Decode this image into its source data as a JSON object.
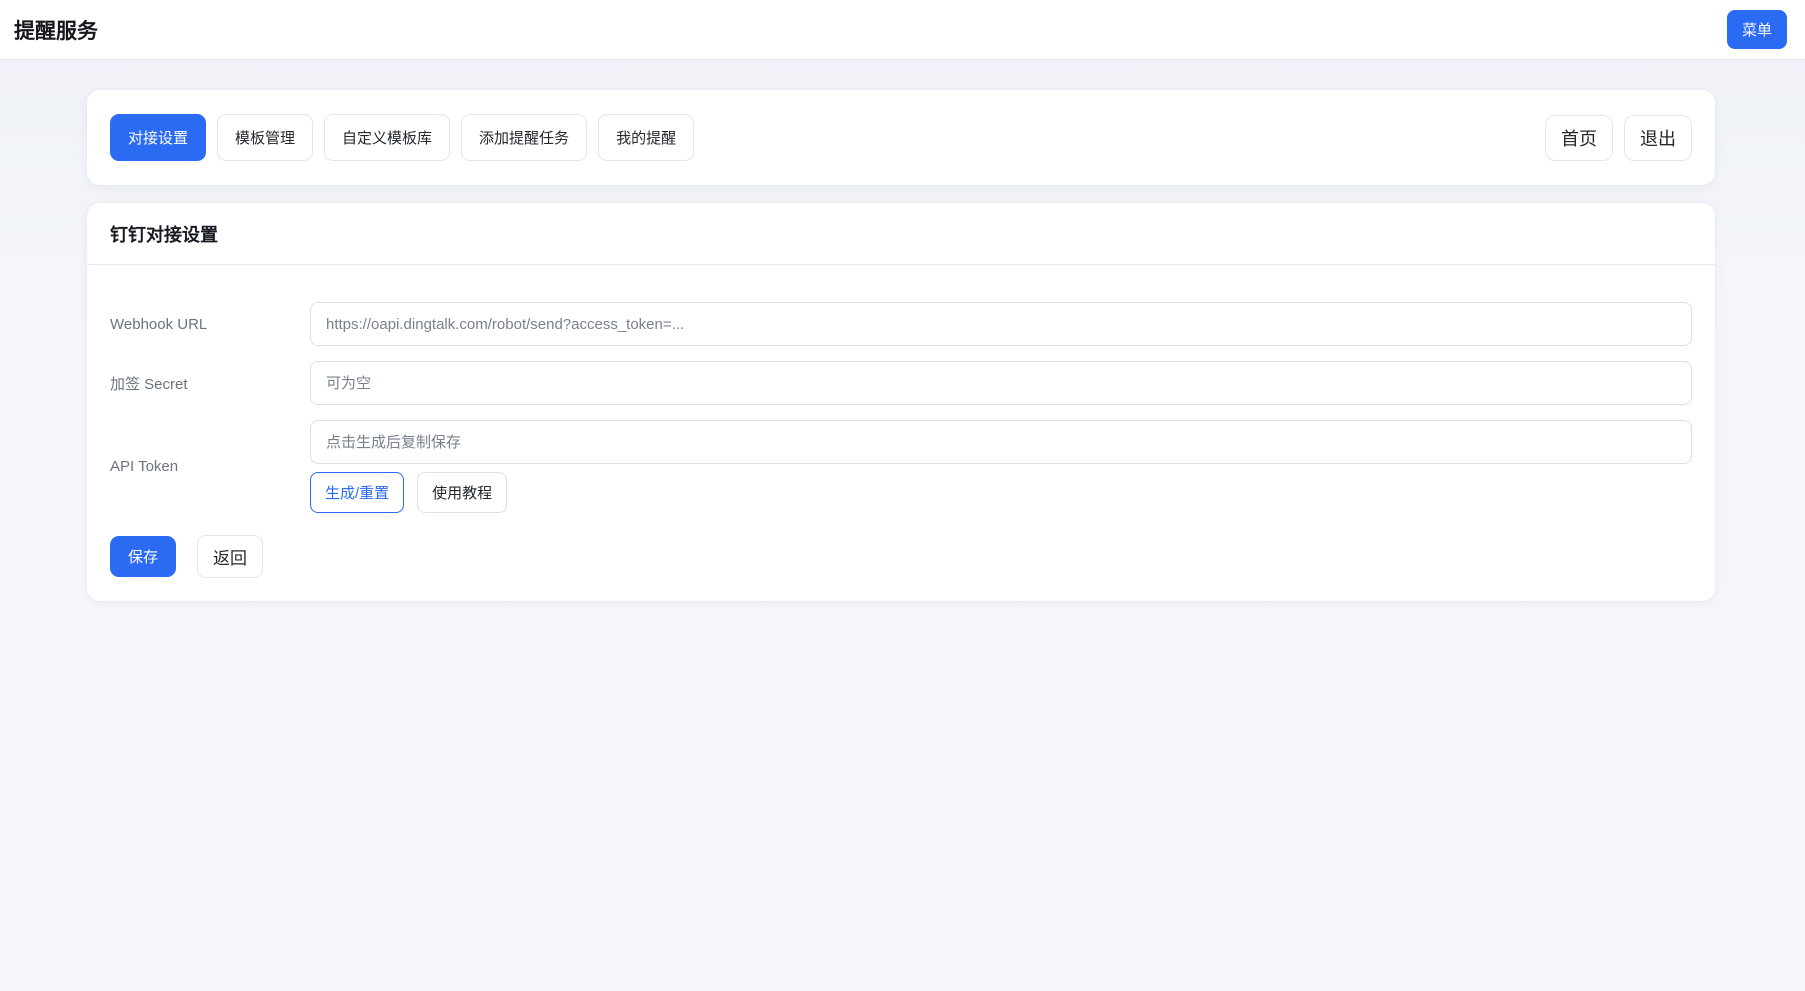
{
  "header": {
    "title": "提醒服务",
    "menu_button": "菜单"
  },
  "nav": {
    "tabs": [
      {
        "label": "对接设置",
        "active": true
      },
      {
        "label": "模板管理",
        "active": false
      },
      {
        "label": "自定义模板库",
        "active": false
      },
      {
        "label": "添加提醒任务",
        "active": false
      },
      {
        "label": "我的提醒",
        "active": false
      }
    ],
    "right_buttons": {
      "home": "首页",
      "logout": "退出"
    }
  },
  "settings": {
    "title": "钉钉对接设置",
    "form": {
      "webhook": {
        "label": "Webhook URL",
        "value": "",
        "placeholder": "https://oapi.dingtalk.com/robot/send?access_token=..."
      },
      "secret": {
        "label": "加签 Secret",
        "value": "",
        "placeholder": "可为空"
      },
      "token": {
        "label": "API Token",
        "value": "",
        "placeholder": "点击生成后复制保存",
        "generate_button": "生成/重置",
        "tutorial_button": "使用教程"
      }
    },
    "actions": {
      "save": "保存",
      "back": "返回"
    }
  },
  "colors": {
    "primary": "#2b6af3",
    "page_background": "#f3f5f9",
    "card_background": "#ffffff"
  }
}
